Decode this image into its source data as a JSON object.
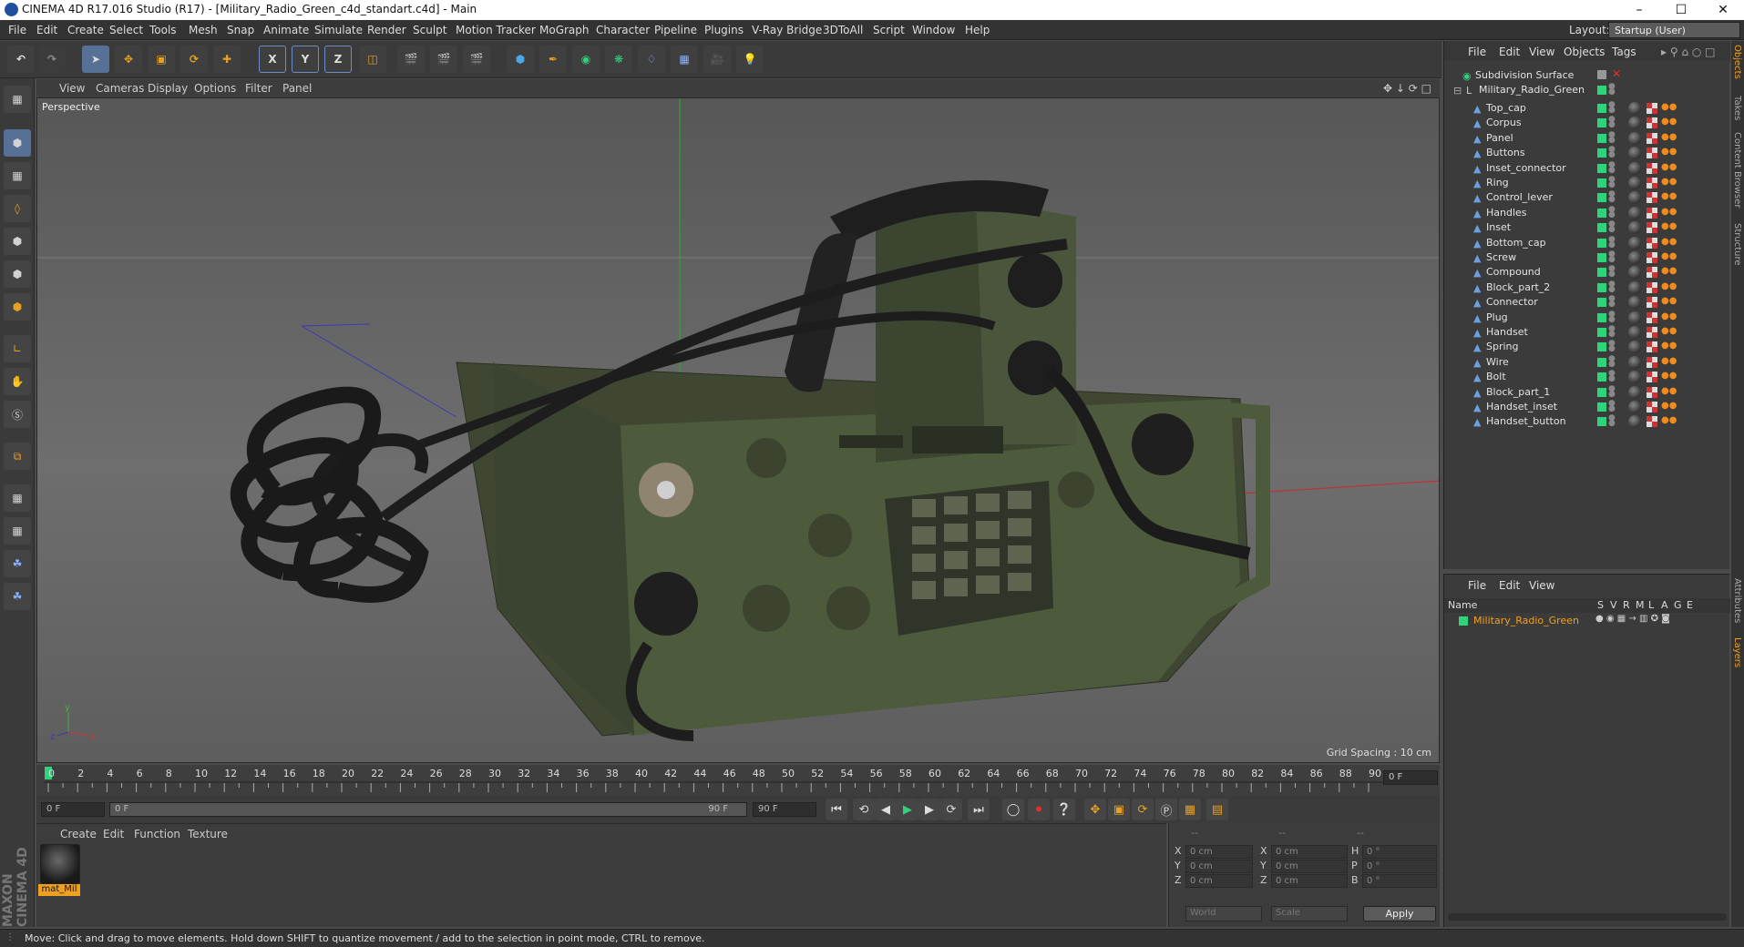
{
  "window": {
    "title": "CINEMA 4D R17.016 Studio (R17) - [Military_Radio_Green_c4d_standart.c4d] - Main",
    "controls": [
      "–",
      "☐",
      "✕"
    ]
  },
  "menu": [
    "File",
    "Edit",
    "Create",
    "Select",
    "Tools",
    "Mesh",
    "Snap",
    "Animate",
    "Simulate",
    "Render",
    "Sculpt",
    "Motion Tracker",
    "MoGraph",
    "Character",
    "Pipeline",
    "Plugins",
    "V-Ray Bridge",
    "3DToAll",
    "Script",
    "Window",
    "Help"
  ],
  "layout": {
    "label": "Layout:",
    "value": "Startup (User)"
  },
  "toolbar": {
    "axis_x": "X",
    "axis_y": "Y",
    "axis_z": "Z"
  },
  "viewport": {
    "menu": [
      "View",
      "Cameras",
      "Display",
      "Options",
      "Filter",
      "Panel"
    ],
    "label": "Perspective",
    "grid_spacing": "Grid Spacing : 10 cm"
  },
  "timeline": {
    "ticks": [
      "0",
      "2",
      "4",
      "6",
      "8",
      "10",
      "12",
      "14",
      "16",
      "18",
      "20",
      "22",
      "24",
      "26",
      "28",
      "30",
      "32",
      "34",
      "36",
      "38",
      "40",
      "42",
      "44",
      "46",
      "48",
      "50",
      "52",
      "54",
      "56",
      "58",
      "60",
      "62",
      "64",
      "66",
      "68",
      "70",
      "72",
      "74",
      "76",
      "78",
      "80",
      "82",
      "84",
      "86",
      "88",
      "90"
    ],
    "current_frame": "0 F"
  },
  "transport": {
    "start": "0 F",
    "range_start": "0 F",
    "range_end": "90 F",
    "end": "90 F"
  },
  "material_manager": {
    "menu": [
      "Create",
      "Edit",
      "Function",
      "Texture"
    ],
    "materials": [
      {
        "name": "mat_Mil"
      }
    ]
  },
  "coordinates": {
    "header": [
      "--",
      "--",
      "--"
    ],
    "pos": [
      {
        "axis": "X",
        "value": "0 cm"
      },
      {
        "axis": "Y",
        "value": "0 cm"
      },
      {
        "axis": "Z",
        "value": "0 cm"
      }
    ],
    "size": [
      {
        "axis": "X",
        "value": "0 cm"
      },
      {
        "axis": "Y",
        "value": "0 cm"
      },
      {
        "axis": "Z",
        "value": "0 cm"
      }
    ],
    "rot": [
      {
        "axis": "H",
        "value": "0 °"
      },
      {
        "axis": "P",
        "value": "0 °"
      },
      {
        "axis": "B",
        "value": "0 °"
      }
    ],
    "mode1": "World",
    "mode2": "Scale",
    "apply": "Apply"
  },
  "object_manager": {
    "menu": [
      "File",
      "Edit",
      "View",
      "Objects",
      "Tags"
    ],
    "root": "Subdivision Surface",
    "group": "Military_Radio_Green",
    "objects": [
      "Top_cap",
      "Corpus",
      "Panel",
      "Buttons",
      "Inset_connector",
      "Ring",
      "Control_lever",
      "Handles",
      "Inset",
      "Bottom_cap",
      "Screw",
      "Compound",
      "Block_part_2",
      "Connector",
      "Plug",
      "Handset",
      "Spring",
      "Wire",
      "Bolt",
      "Block_part_1",
      "Handset_inset",
      "Handset_button"
    ]
  },
  "layer_manager": {
    "menu": [
      "File",
      "Edit",
      "View"
    ],
    "columns": {
      "name": "Name",
      "flags": [
        "S",
        "V",
        "R",
        "M",
        "L",
        "A",
        "G",
        "E"
      ]
    },
    "layers": [
      {
        "name": "Military_Radio_Green",
        "color": "#2ed47a"
      }
    ]
  },
  "side_tabs": [
    "Objects",
    "Takes",
    "Content Browser",
    "Structure",
    "Attributes",
    "Layers"
  ],
  "status": "Move: Click and drag to move elements. Hold down SHIFT to quantize movement / add to the selection in point mode, CTRL to remove.",
  "brand": "MAXON CINEMA 4D",
  "colors": {
    "accent_green": "#2ed47a",
    "selection_orange": "#f0a020",
    "active_blue": "#577096"
  }
}
